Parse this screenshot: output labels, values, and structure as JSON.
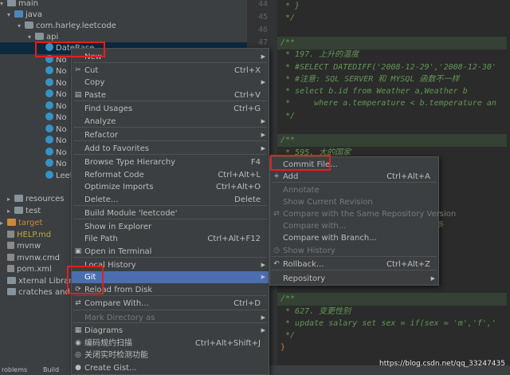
{
  "project_tree": {
    "rows": [
      {
        "label": "main",
        "kind": "folder",
        "arrow": "▾"
      },
      {
        "label": "java",
        "kind": "src",
        "arrow": "▾"
      },
      {
        "label": "com.harley.leetcode",
        "kind": "pkg",
        "arrow": "▾"
      },
      {
        "label": "api",
        "kind": "pkg",
        "arrow": "▾"
      },
      {
        "label": "DateBase",
        "kind": "class",
        "arrow": "",
        "selected": true
      },
      {
        "label": "No",
        "kind": "class",
        "arrow": ""
      },
      {
        "label": "No",
        "kind": "class",
        "arrow": ""
      },
      {
        "label": "No",
        "kind": "class",
        "arrow": ""
      },
      {
        "label": "No",
        "kind": "class",
        "arrow": ""
      },
      {
        "label": "No",
        "kind": "class",
        "arrow": ""
      },
      {
        "label": "No",
        "kind": "class",
        "arrow": ""
      },
      {
        "label": "No",
        "kind": "class",
        "arrow": ""
      },
      {
        "label": "No",
        "kind": "class",
        "arrow": ""
      },
      {
        "label": "No",
        "kind": "class",
        "arrow": ""
      },
      {
        "label": "No",
        "kind": "class",
        "arrow": ""
      },
      {
        "label": "Leetco",
        "kind": "class",
        "arrow": ""
      },
      {
        "label": "resources",
        "kind": "folder",
        "arrow": "▸"
      },
      {
        "label": "test",
        "kind": "folder",
        "arrow": "▸"
      },
      {
        "label": "target",
        "kind": "target",
        "arrow": "▸"
      },
      {
        "label": "HELP.md",
        "kind": "file",
        "arrow": ""
      },
      {
        "label": "mvnw",
        "kind": "file",
        "arrow": ""
      },
      {
        "label": "mvnw.cmd",
        "kind": "file",
        "arrow": ""
      },
      {
        "label": "pom.xml",
        "kind": "file",
        "arrow": ""
      },
      {
        "label": "xternal Libraries",
        "kind": "folder",
        "arrow": ""
      },
      {
        "label": "cratches and Consol",
        "kind": "folder",
        "arrow": ""
      }
    ]
  },
  "editor": {
    "line_numbers": [
      "44",
      "45",
      "46",
      "47"
    ],
    "lines": [
      {
        "text": " * }",
        "style": "plain"
      },
      {
        "text": " */",
        "style": "plain"
      },
      {
        "text": "",
        "style": "plain"
      },
      {
        "text": "/**",
        "style": "hl"
      },
      {
        "text": " * 197. 上升的温度",
        "style": "plain"
      },
      {
        "text": " * #SELECT DATEDIFF('2008-12-29','2008-12-30'",
        "style": "plain"
      },
      {
        "text": " * #注意: SQL SERVER 和 MYSQL 函数不一样",
        "style": "plain"
      },
      {
        "text": " * select b.id from Weather a,Weather b",
        "style": "plain"
      },
      {
        "text": " *     where a.temperature < b.temperature an",
        "style": "plain"
      },
      {
        "text": " */",
        "style": "plain"
      },
      {
        "text": "",
        "style": "plain"
      },
      {
        "text": "/**",
        "style": "hl"
      },
      {
        "text": " * 595. 大的国家",
        "style": "plain"
      },
      {
        "text": "                 a from World whe",
        "style": "plain"
      },
      {
        "text": "",
        "style": "plain"
      },
      {
        "text": "",
        "style": "plain"
      },
      {
        "text": "",
        "style": "plain"
      },
      {
        "text": "",
        "style": "plain"
      },
      {
        "text": "                 出现多条, 只能算一条",
        "style": "plain"
      },
      {
        "text": "",
        "style": "plain"
      },
      {
        "text": "                 student from cou",
        "style": "plain"
      },
      {
        "text": "                 having count(cla",
        "style": "plain"
      },
      {
        "text": "",
        "style": "plain"
      },
      {
        "text": "",
        "style": "plain"
      },
      {
        "text": "/**",
        "style": "hl"
      },
      {
        "text": " * 627. 变更性别",
        "style": "plain"
      },
      {
        "text": " * update salary set sex = if(sex = 'm','f','",
        "style": "plain"
      },
      {
        "text": " */",
        "style": "plain"
      },
      {
        "text": "}",
        "style": "brace"
      }
    ]
  },
  "context_menu": {
    "items": [
      {
        "label": "New",
        "shortcut": "",
        "submenu": true,
        "icon": ""
      },
      {
        "label": "Cut",
        "shortcut": "Ctrl+X",
        "icon": "✂"
      },
      {
        "label": "Copy",
        "shortcut": "",
        "submenu": true,
        "icon": ""
      },
      {
        "label": "Paste",
        "shortcut": "Ctrl+V",
        "icon": "▤"
      },
      {
        "label": "Find Usages",
        "shortcut": "Ctrl+G",
        "icon": ""
      },
      {
        "label": "Analyze",
        "shortcut": "",
        "submenu": true,
        "icon": ""
      },
      {
        "label": "Refactor",
        "shortcut": "",
        "submenu": true,
        "icon": ""
      },
      {
        "label": "Add to Favorites",
        "shortcut": "",
        "submenu": true,
        "icon": ""
      },
      {
        "label": "Browse Type Hierarchy",
        "shortcut": "F4",
        "icon": ""
      },
      {
        "label": "Reformat Code",
        "shortcut": "Ctrl+Alt+L",
        "icon": ""
      },
      {
        "label": "Optimize Imports",
        "shortcut": "Ctrl+Alt+O",
        "icon": ""
      },
      {
        "label": "Delete...",
        "shortcut": "Delete",
        "icon": ""
      },
      {
        "label": "Build Module 'leetcode'",
        "shortcut": "",
        "icon": ""
      },
      {
        "label": "Show in Explorer",
        "shortcut": "",
        "icon": ""
      },
      {
        "label": "File Path",
        "shortcut": "Ctrl+Alt+F12",
        "icon": ""
      },
      {
        "label": "Open in Terminal",
        "shortcut": "",
        "icon": "▣"
      },
      {
        "label": "Local History",
        "shortcut": "",
        "submenu": true,
        "icon": ""
      },
      {
        "label": "Git",
        "shortcut": "",
        "submenu": true,
        "icon": "",
        "active": true
      },
      {
        "label": "Reload from Disk",
        "shortcut": "",
        "icon": "⟳"
      },
      {
        "label": "Compare With...",
        "shortcut": "Ctrl+D",
        "icon": "⇄"
      },
      {
        "label": "Mark Directory as",
        "shortcut": "",
        "submenu": true,
        "icon": "",
        "disabled": true
      },
      {
        "label": "Diagrams",
        "shortcut": "",
        "submenu": true,
        "icon": "▦"
      },
      {
        "label": "编码规约扫描",
        "shortcut": "Ctrl+Alt+Shift+J",
        "icon": "◉"
      },
      {
        "label": "关闭实时检测功能",
        "shortcut": "",
        "icon": "◎"
      },
      {
        "label": "Create Gist...",
        "shortcut": "",
        "icon": "●"
      }
    ]
  },
  "git_submenu": {
    "items": [
      {
        "label": "Commit File...",
        "shortcut": "",
        "icon": ""
      },
      {
        "label": "Add",
        "shortcut": "Ctrl+Alt+A",
        "icon": "+"
      },
      {
        "label": "Annotate",
        "shortcut": "",
        "icon": "",
        "disabled": true
      },
      {
        "label": "Show Current Revision",
        "shortcut": "",
        "icon": "",
        "disabled": true
      },
      {
        "label": "Compare with the Same Repository Version",
        "shortcut": "",
        "icon": "⇄",
        "disabled": true
      },
      {
        "label": "Compare with...",
        "shortcut": "",
        "icon": "",
        "disabled": true
      },
      {
        "label": "Compare with Branch...",
        "shortcut": "",
        "icon": ""
      },
      {
        "label": "Show History",
        "shortcut": "",
        "icon": "◷",
        "disabled": true
      },
      {
        "label": "Rollback...",
        "shortcut": "Ctrl+Alt+Z",
        "icon": "↶"
      },
      {
        "label": "Repository",
        "shortcut": "",
        "submenu": true,
        "icon": ""
      }
    ]
  },
  "status_bar": {
    "left_items": [
      "roblems",
      "Build"
    ],
    "watermark": "https://blog.csdn.net/qq_33247435"
  },
  "colors": {
    "menu_bg": "#3c3f41",
    "menu_active": "#4b6eaf",
    "editor_bg": "#2b2b2b",
    "highlight_box": "#e02020",
    "doc_comment": "#629755"
  }
}
